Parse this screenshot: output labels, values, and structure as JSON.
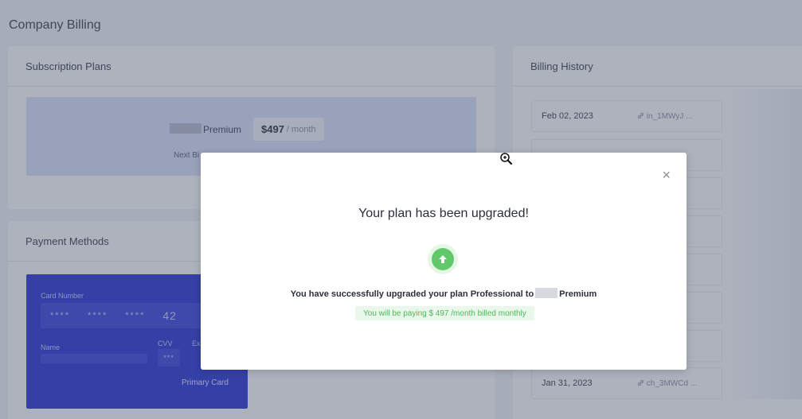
{
  "page": {
    "title": "Company Billing"
  },
  "subscription": {
    "heading": "Subscription Plans",
    "plan_name": "Premium",
    "price": "$497",
    "price_unit": "/ month",
    "next_billing": "Next Bi"
  },
  "payment": {
    "heading": "Payment Methods",
    "card_number_label": "Card Number",
    "masked_groups": [
      "****",
      "****",
      "****"
    ],
    "last_digits": "42",
    "name_label": "Name",
    "cvv_label": "CVV",
    "cvv_value": "***",
    "exp_label": "Ex",
    "primary_label": "Primary Card"
  },
  "history": {
    "heading": "Billing History",
    "rows": [
      {
        "date": "Feb 02, 2023",
        "link": "in_1MWyJ ..."
      },
      {
        "date": "Jan 31, 2023",
        "link": "ch_3MWCd ..."
      }
    ]
  },
  "modal": {
    "title": "Your plan has been upgraded!",
    "message_prefix": "You have successfully upgraded your plan Professional to",
    "message_suffix": "Premium",
    "note": "You will be paying $ 497 /month billed monthly",
    "close_symbol": "×"
  },
  "colors": {
    "accent_blue": "#2a35d6",
    "success_green": "#62c96b"
  }
}
